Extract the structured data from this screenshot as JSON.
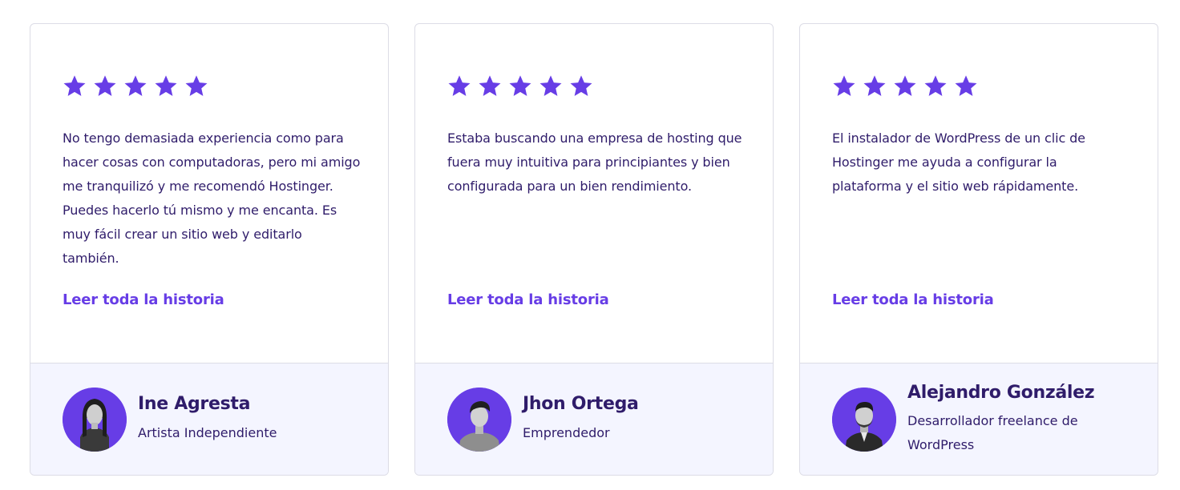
{
  "accent_color": "#673de6",
  "text_color": "#2f1c6a",
  "footer_bg": "#f4f5ff",
  "testimonials": [
    {
      "rating": 5,
      "quote": "No tengo demasiada experiencia como para hacer cosas con computadoras, pero mi amigo me tranquilizó y me recomendó Hostinger. Puedes hacerlo tú mismo y me encanta. Es muy fácil crear un sitio web y editarlo también.",
      "link_label": "Leer toda la historia",
      "name": "Ine Agresta",
      "role": "Artista Independiente",
      "avatar_icon": "person-photo-icon"
    },
    {
      "rating": 5,
      "quote": "Estaba buscando una empresa de hosting que fuera muy intuitiva para principiantes y bien configurada para un bien rendimiento.",
      "link_label": "Leer toda la historia",
      "name": "Jhon Ortega",
      "role": "Emprendedor",
      "avatar_icon": "person-photo-icon"
    },
    {
      "rating": 5,
      "quote": "El instalador de WordPress de un clic de Hostinger me ayuda a configurar la plataforma y el sitio web rápidamente.",
      "link_label": "Leer toda la historia",
      "name": "Alejandro González",
      "role": "Desarrollador freelance de WordPress",
      "avatar_icon": "person-photo-icon"
    }
  ]
}
